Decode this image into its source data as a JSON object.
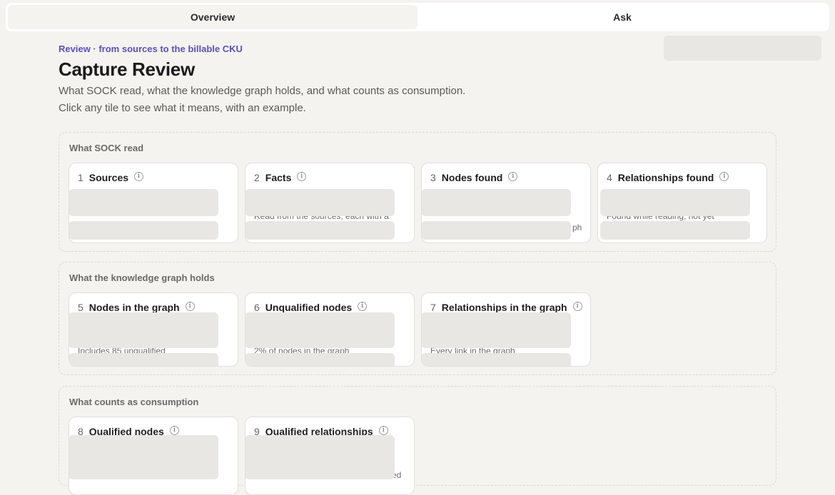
{
  "tabs": [
    {
      "label": "Overview",
      "active": true
    },
    {
      "label": "Ask",
      "active": false
    }
  ],
  "header": {
    "kicker": "Review · from sources to the billable CKU",
    "title": "Capture Review",
    "description_line1": "What SOCK read, what the knowledge graph holds, and what counts as consumption.",
    "description_line2": "Click any tile to see what it means, with an example."
  },
  "sections": [
    {
      "label": "What SOCK read",
      "tiles": [
        {
          "num": "1",
          "name": "Sources",
          "desc": ""
        },
        {
          "num": "2",
          "name": "Facts",
          "desc": "Read from the sources, each with a"
        },
        {
          "num": "3",
          "name": "Nodes found",
          "desc": "",
          "edge": "ph"
        },
        {
          "num": "4",
          "name": "Relationships found",
          "desc": "Found while reading, not yet"
        }
      ]
    },
    {
      "label": "What the knowledge graph holds",
      "tiles": [
        {
          "num": "5",
          "name": "Nodes in the graph",
          "desc": "Includes 85 unqualified"
        },
        {
          "num": "6",
          "name": "Unqualified nodes",
          "desc": "2% of nodes in the graph"
        },
        {
          "num": "7",
          "name": "Relationships in the graph",
          "desc": "Every link in the graph"
        }
      ]
    },
    {
      "label": "What counts as consumption",
      "tiles": [
        {
          "num": "8",
          "name": "Qualified nodes",
          "desc": ""
        },
        {
          "num": "9",
          "name": "Qualified relationships",
          "desc": "",
          "edge": "ed"
        }
      ]
    }
  ],
  "colors": {
    "background": "#f4f3ef",
    "accent": "#5b4fc2",
    "skeleton": "#e8e7e3"
  }
}
